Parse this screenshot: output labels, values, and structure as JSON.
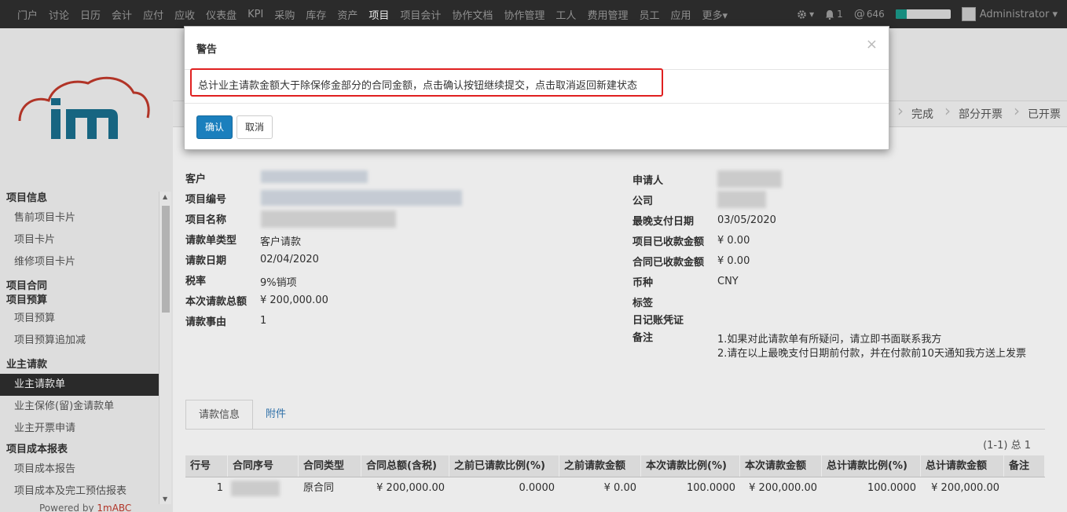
{
  "nav": {
    "items": [
      "门户",
      "讨论",
      "日历",
      "会计",
      "应付",
      "应收",
      "仪表盘",
      "KPI",
      "采购",
      "库存",
      "资产",
      "项目",
      "项目会计",
      "协作文档",
      "协作管理",
      "工人",
      "费用管理",
      "员工",
      "应用",
      "更多▾"
    ],
    "active_index": 11,
    "settings_label": "▾",
    "notifications": "1",
    "messages": "646",
    "progress_fraction": 0.2,
    "user": "Administrator ▾"
  },
  "sidebar": {
    "sections": [
      {
        "title": "项目信息",
        "items": [
          "售前项目卡片",
          "项目卡片",
          "维修项目卡片"
        ]
      },
      {
        "title": "项目合同",
        "items": []
      },
      {
        "title": "项目预算",
        "items": [
          "项目预算",
          "项目预算追加减"
        ]
      },
      {
        "title": "业主请款",
        "items": [
          "业主请款单",
          "业主保修(留)金请款单",
          "业主开票申请"
        ]
      },
      {
        "title": "项目成本报表",
        "items": [
          "项目成本报告",
          "项目成本及完工预估报表"
        ]
      }
    ],
    "active_item": "业主请款单",
    "powered_prefix": "Powered by ",
    "powered_brand": "1mABC"
  },
  "statusbar": {
    "stages": [
      "完成",
      "部分开票",
      "已开票"
    ]
  },
  "form": {
    "left": {
      "labels": [
        "客户",
        "项目编号",
        "项目名称",
        "请款单类型",
        "请款日期",
        "税率",
        "本次请款总额",
        "请款事由"
      ],
      "values": [
        "",
        "",
        "",
        "客户请款",
        "02/04/2020",
        "9%销项",
        "¥ 200,000.00",
        "1"
      ]
    },
    "right": {
      "labels": [
        "申请人",
        "公司",
        "最晚支付日期",
        "项目已收款金额",
        "合同已收款金额",
        "币种",
        "标签",
        "日记账凭证",
        "备注"
      ],
      "values": [
        "",
        "",
        "03/05/2020",
        "¥ 0.00",
        "¥ 0.00",
        "CNY",
        "",
        "",
        ""
      ],
      "notes": [
        "1.如果对此请款单有所疑问，请立即书面联系我方",
        "2.请在以上最晚支付日期前付款，并在付款前10天通知我方送上发票"
      ]
    }
  },
  "tabs": [
    "请款信息",
    "附件"
  ],
  "pager": "(1-1) 总 1",
  "table": {
    "headers": [
      "行号",
      "合同序号",
      "合同类型",
      "合同总额(含税)",
      "之前已请款比例(%)",
      "之前请款金额",
      "本次请款比例(%)",
      "本次请款金额",
      "总计请款比例(%)",
      "总计请款金额",
      "备注"
    ],
    "rows": [
      [
        "1",
        "",
        "原合同",
        "¥ 200,000.00",
        "0.0000",
        "¥ 0.00",
        "100.0000",
        "¥ 200,000.00",
        "100.0000",
        "¥ 200,000.00",
        ""
      ]
    ]
  },
  "modal": {
    "title": "警告",
    "close": "×",
    "message": "总计业主请款金额大于除保修金部分的合同金额，点击确认按钮继续提交，点击取消返回新建状态",
    "ok_label": "确认",
    "cancel_label": "取消"
  }
}
